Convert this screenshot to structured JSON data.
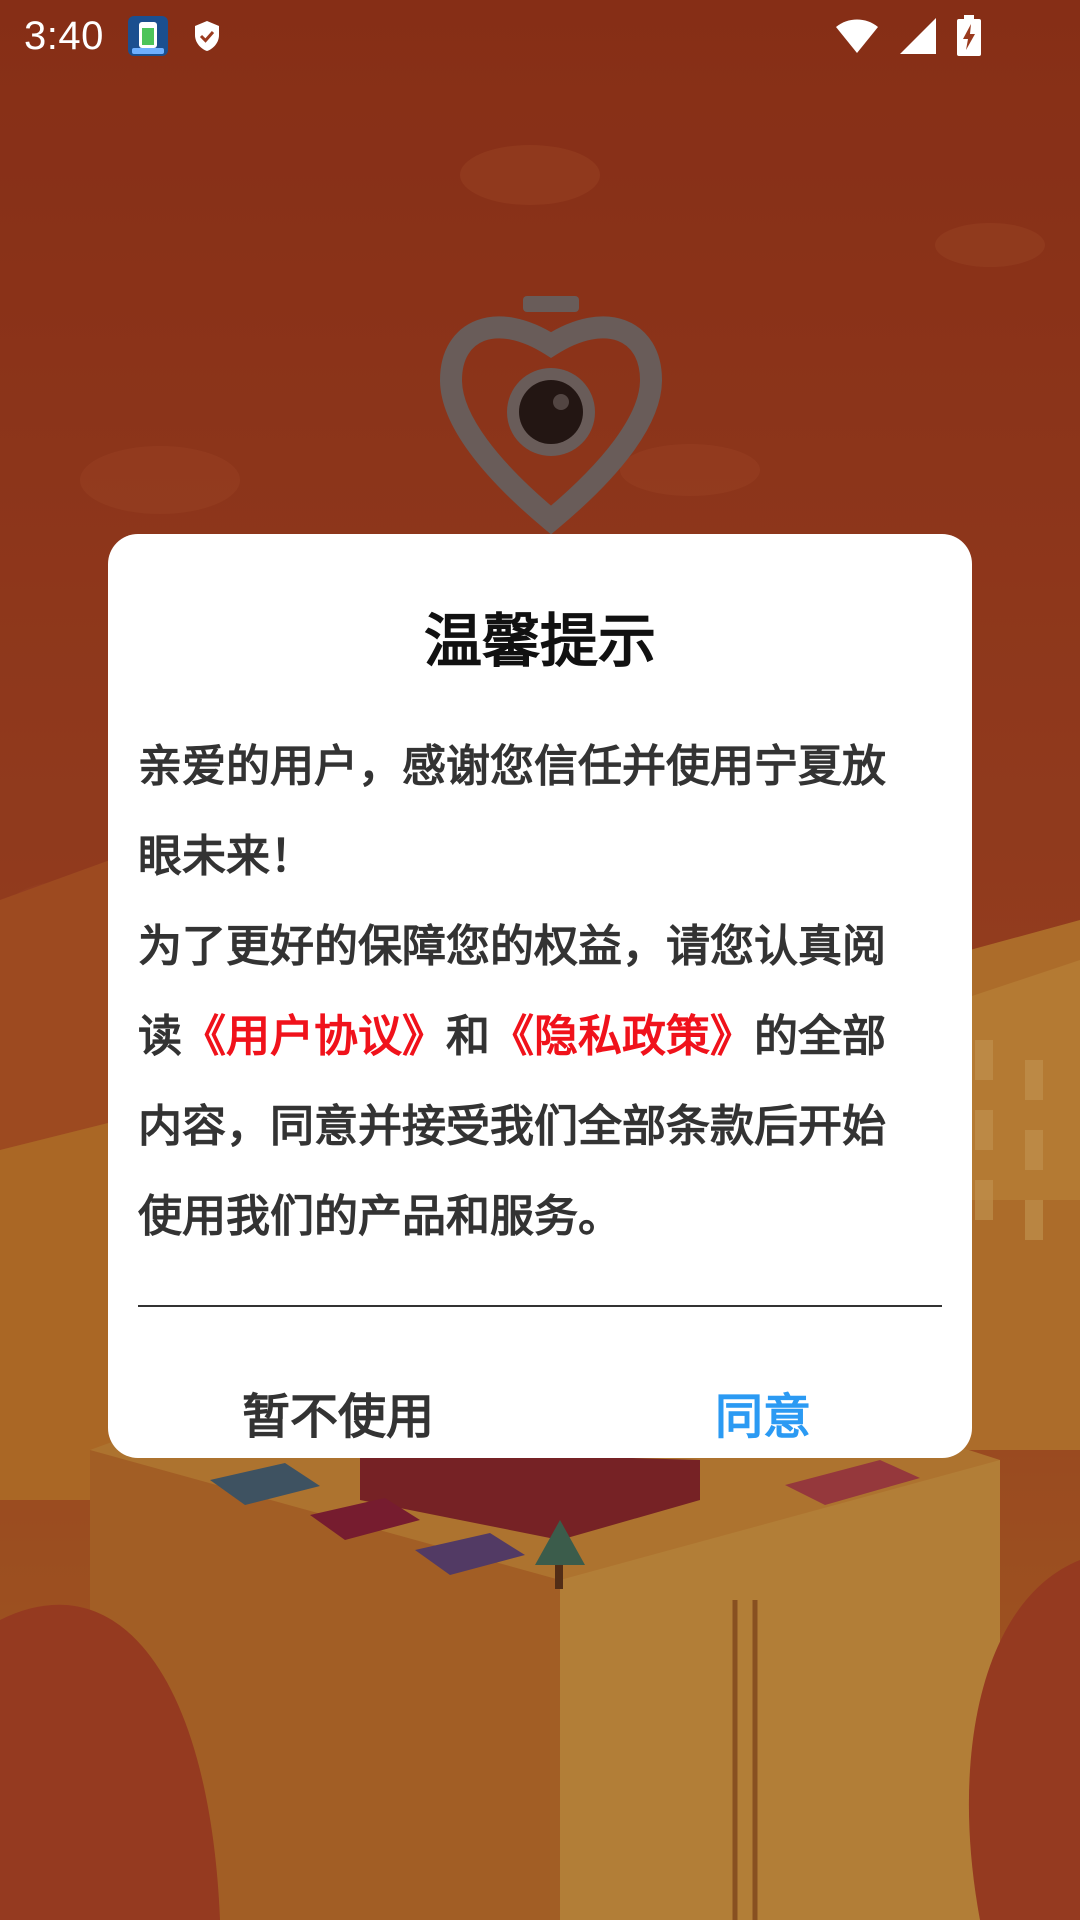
{
  "status_bar": {
    "time": "3:40",
    "left_icons": [
      "app-notification-icon",
      "shield-icon"
    ],
    "right_icons": [
      "wifi-icon",
      "cellular-signal-icon",
      "battery-charging-icon"
    ]
  },
  "background": {
    "logo_icon": "heart-camera-logo-icon"
  },
  "dialog": {
    "title": "温馨提示",
    "paragraph1": "亲爱的用户，感谢您信任并使用宁夏放眼未来！",
    "p2_prefix": "为了更好的保障您的权益，请您认真阅读",
    "user_agreement_link": "《用户协议》",
    "p2_middle": "和",
    "privacy_policy_link": "《隐私政策》",
    "p2_suffix": "的全部内容，同意并接受我们全部条款后开始使用我们的产品和服务。",
    "decline_button": "暂不使用",
    "agree_button": "同意"
  },
  "colors": {
    "link": "#f0121b",
    "agree": "#2b9af3",
    "background": "#9a3a1e"
  }
}
